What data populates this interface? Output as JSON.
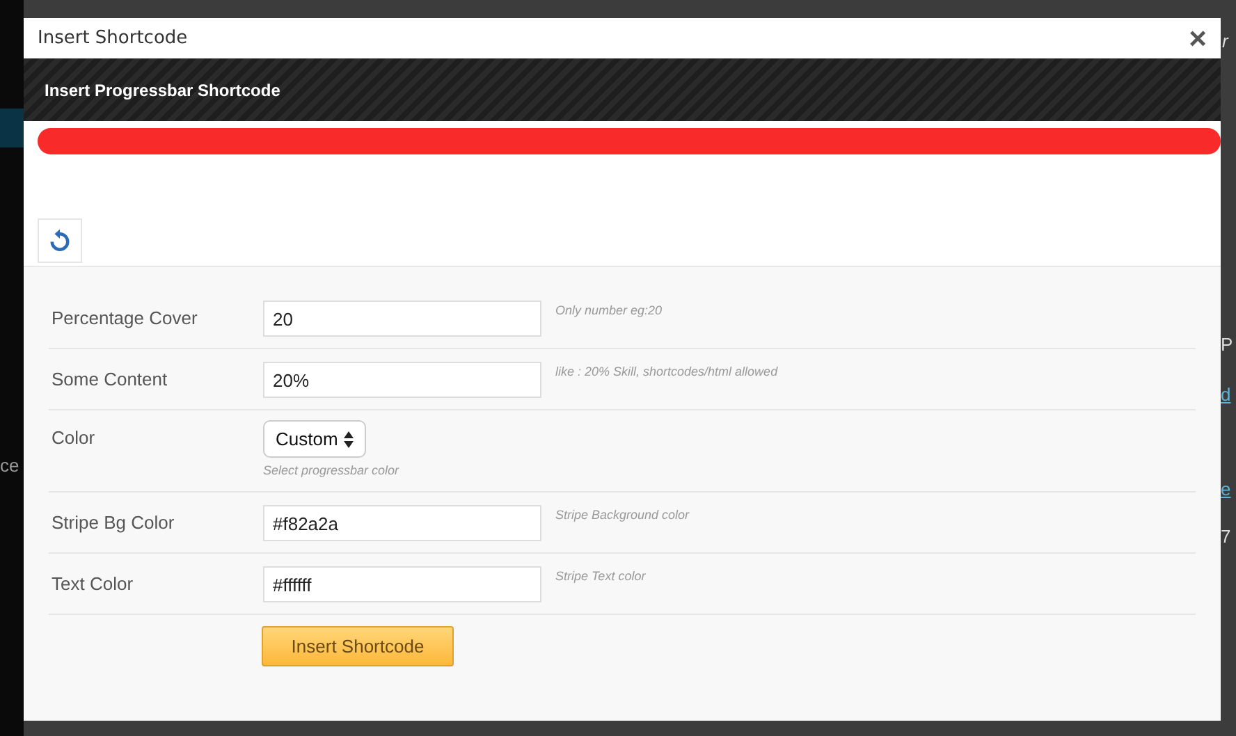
{
  "backdrop": {
    "fragments": [
      {
        "text": "r",
        "kind": "italic"
      },
      {
        "text": "ce",
        "kind": "muted"
      },
      {
        "text": "P",
        "kind": "plain"
      },
      {
        "text": "d",
        "kind": "link"
      },
      {
        "text": "e",
        "kind": "link"
      },
      {
        "text": "7",
        "kind": "plain"
      }
    ]
  },
  "dialog": {
    "title": "Insert Shortcode",
    "close": "×"
  },
  "banner": {
    "title": "Insert Progressbar Shortcode"
  },
  "preview": {
    "level": 1,
    "color": "#f82a2a"
  },
  "fields": [
    {
      "kind": "text",
      "label": "Percentage Cover",
      "value": "20",
      "hint": "Only number eg:20"
    },
    {
      "kind": "text",
      "label": "Some Content",
      "value": "20%",
      "hint": "like : 20% Skill, shortcodes/html allowed"
    },
    {
      "kind": "select",
      "label": "Color",
      "value": "Custom",
      "hint": "Select progressbar color"
    },
    {
      "kind": "text",
      "label": "Stripe Bg Color",
      "value": "#f82a2a",
      "hint": "Stripe Background color"
    },
    {
      "kind": "text",
      "label": "Text Color",
      "value": "#ffffff",
      "hint": "Stripe Text color"
    }
  ],
  "submit": "Insert Shortcode"
}
